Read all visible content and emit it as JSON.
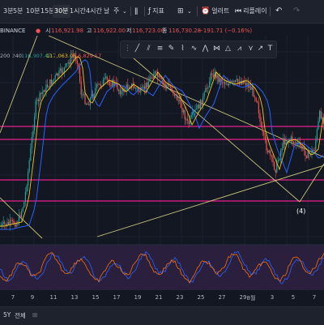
{
  "toolbar": {
    "timeframes": [
      "3분",
      "5분",
      "10분",
      "15분",
      "30분",
      "1시간",
      "4시간",
      "날",
      "주"
    ],
    "active_timeframe": "30분",
    "indicators_label": "지표",
    "alert_label": "얼러트",
    "replay_label": "리플레이",
    "undo_icon": "undo-icon",
    "redo_icon": "redo-icon"
  },
  "legend": {
    "exchange": "BINANCE",
    "open_label": "시",
    "open_value": "116,921.98",
    "high_label": "고",
    "high_value": "116,922.00",
    "low_label": "저",
    "low_value": "116,723.00",
    "close_label": "종",
    "close_value": "116,730.28",
    "change": "−191.71 (−0.16%)"
  },
  "indicator_legend": {
    "periods": "200 240",
    "values": [
      "116,907.47",
      "117,063.05",
      "116,829.57"
    ]
  },
  "drawing_toolbar": {
    "tools": [
      "line-tool-icon",
      "channel-tool-icon",
      "fib-tool-icon",
      "pen-tool-icon",
      "zigzag-tool-icon",
      "wave-tool-icon",
      "pattern-tool-icon",
      "xabcd-tool-icon",
      "triangle-tool-icon",
      "head-shoulders-tool-icon",
      "abcd-tool-icon",
      "arrow-tool-icon",
      "text-tool-icon"
    ]
  },
  "chart_annotations": {
    "wave_label": "(4)"
  },
  "time_axis": {
    "labels": [
      "7",
      "9",
      "11",
      "13",
      "15",
      "17",
      "19",
      "21",
      "23",
      "25",
      "27",
      "29",
      "8월",
      "3",
      "5",
      "7"
    ]
  },
  "bottom_bar": {
    "ranges": [
      "5Y",
      "전체"
    ]
  },
  "colors": {
    "background": "#131722",
    "up": "#26a69a",
    "down": "#ef5350",
    "magenta_levels": "#e91e8c",
    "trendline": "#c8c27a",
    "ma_fast": "#f5c518",
    "ma_slow": "#2962ff",
    "stoch_k": "#2962ff",
    "stoch_d": "#ff6d00"
  }
}
